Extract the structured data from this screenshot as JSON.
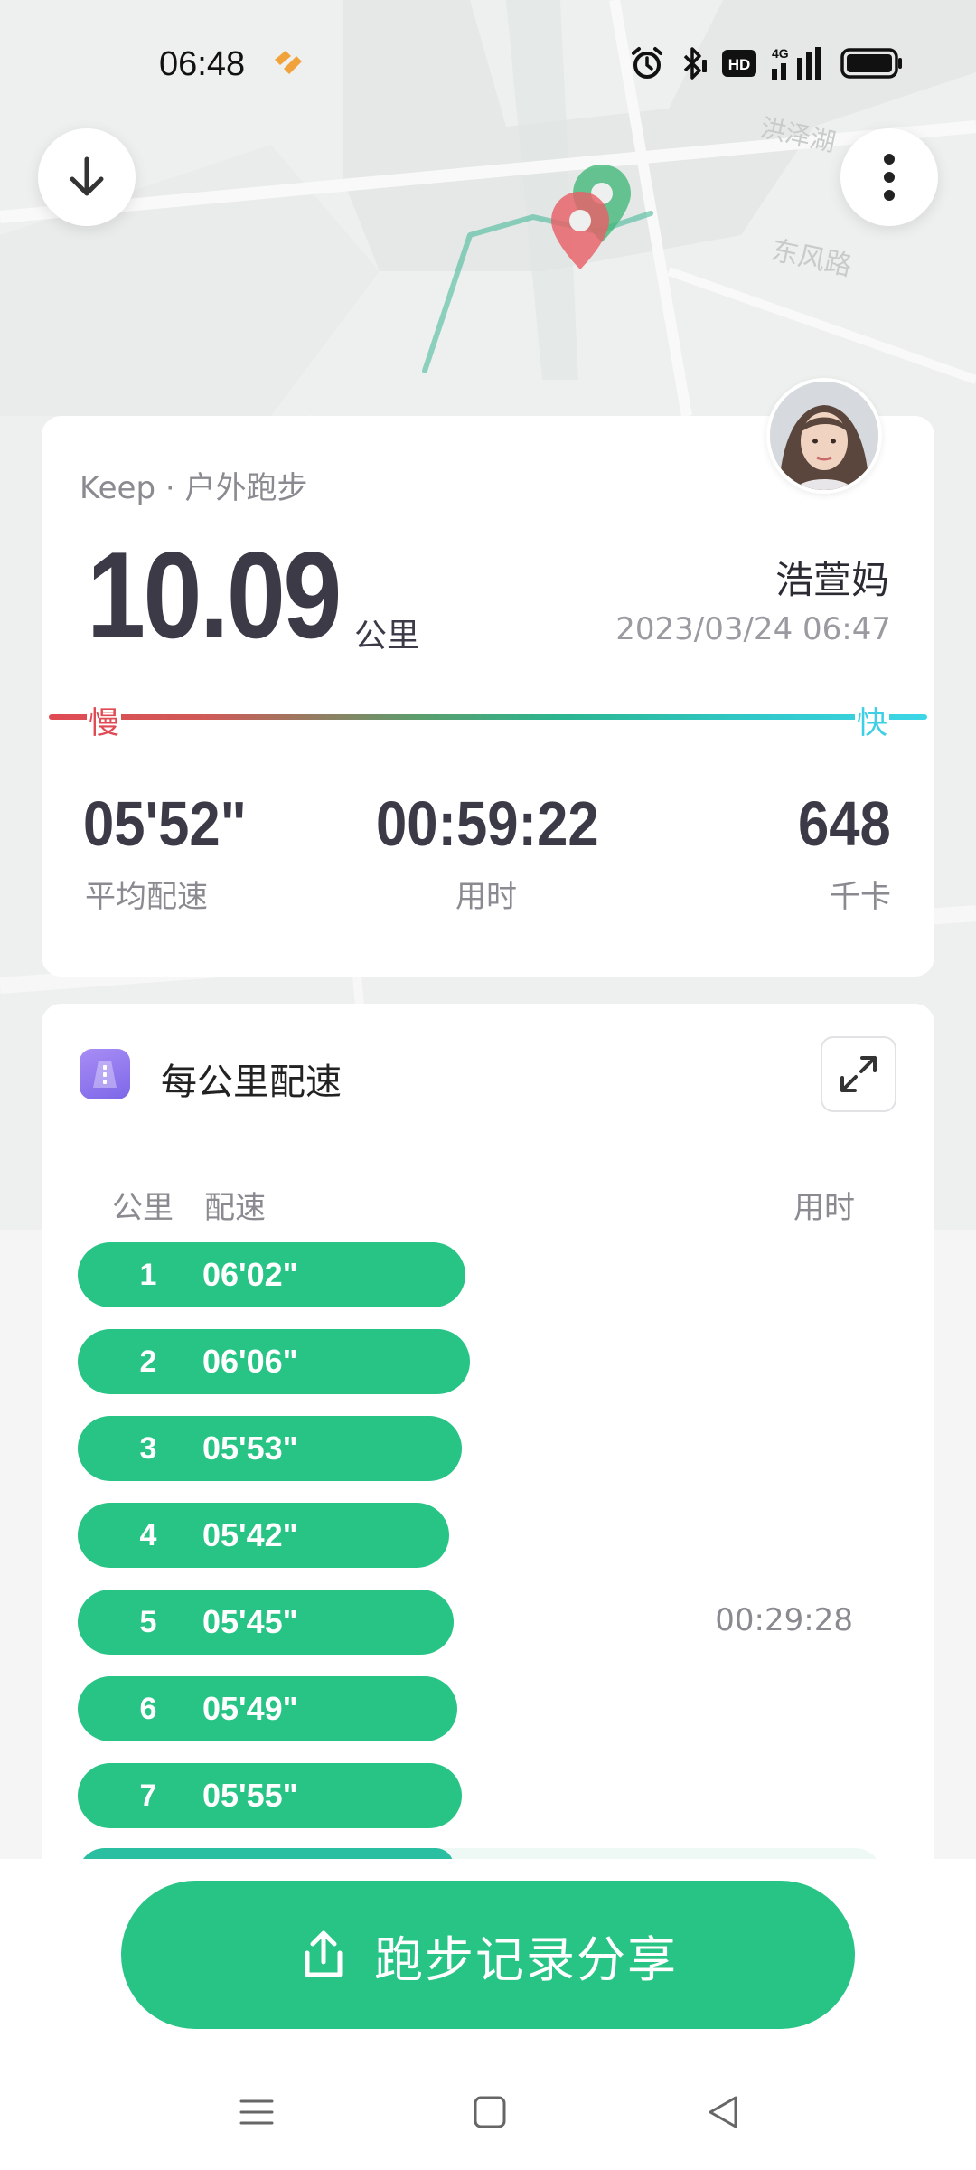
{
  "status_bar": {
    "time": "06:48",
    "network": "4G",
    "hd": "HD"
  },
  "map": {
    "road_label_1": "东风路",
    "road_label_2": "洪泽湖"
  },
  "summary": {
    "source": "Keep · 户外跑步",
    "distance": "10.09",
    "distance_unit": "公里",
    "user_name": "浩萱妈",
    "date": "2023/03/24 06:47",
    "slow_label": "慢",
    "fast_label": "快",
    "avg_pace": "05'52\"",
    "avg_pace_label": "平均配速",
    "duration": "00:59:22",
    "duration_label": "用时",
    "calories": "648",
    "calories_label": "千卡"
  },
  "pace_section": {
    "title": "每公里配速",
    "col_km": "公里",
    "col_pace": "配速",
    "col_time": "用时",
    "rows": [
      {
        "km": "1",
        "pace": "06'02\"",
        "time": "",
        "fill": 0.95
      },
      {
        "km": "2",
        "pace": "06'06\"",
        "time": "",
        "fill": 0.96
      },
      {
        "km": "3",
        "pace": "05'53\"",
        "time": "",
        "fill": 0.94
      },
      {
        "km": "4",
        "pace": "05'42\"",
        "time": "",
        "fill": 0.91
      },
      {
        "km": "5",
        "pace": "05'45\"",
        "time": "00:29:28",
        "fill": 0.92
      },
      {
        "km": "6",
        "pace": "05'49\"",
        "time": "",
        "fill": 0.93
      },
      {
        "km": "7",
        "pace": "05'55\"",
        "time": "",
        "fill": 0.94
      }
    ]
  },
  "share_button": {
    "label": "跑步记录分享"
  },
  "colors": {
    "accent_green": "#28c485",
    "slow_red": "#e04a53",
    "fast_cyan": "#3dd6e8",
    "text_dark": "#3d3a48"
  },
  "icons": [
    "arrow-down-icon",
    "more-vertical-icon",
    "route-end-pin-icon",
    "route-start-pin-icon",
    "pace-icon",
    "expand-icon",
    "share-icon",
    "menu-icon",
    "home-icon",
    "back-icon",
    "alarm-icon",
    "bluetooth-icon",
    "battery-icon"
  ]
}
